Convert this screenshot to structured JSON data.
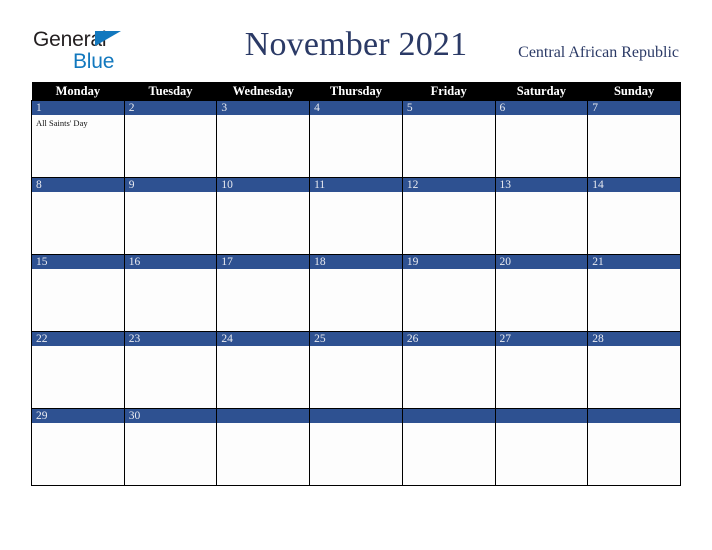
{
  "brand": {
    "name_part1": "General",
    "name_part2": "Blue",
    "triangle_icon": "triangle-icon",
    "color_primary": "#1278be",
    "color_text": "#231f20"
  },
  "header": {
    "title": "November 2021",
    "country": "Central African Republic",
    "title_color": "#2b3a66"
  },
  "calendar": {
    "accent_color": "#2e5191",
    "header_bg": "#000000",
    "weekday_headers": [
      "Monday",
      "Tuesday",
      "Wednesday",
      "Thursday",
      "Friday",
      "Saturday",
      "Sunday"
    ],
    "weeks": [
      [
        {
          "day": "1",
          "events": [
            "All Saints' Day"
          ]
        },
        {
          "day": "2",
          "events": []
        },
        {
          "day": "3",
          "events": []
        },
        {
          "day": "4",
          "events": []
        },
        {
          "day": "5",
          "events": []
        },
        {
          "day": "6",
          "events": []
        },
        {
          "day": "7",
          "events": []
        }
      ],
      [
        {
          "day": "8",
          "events": []
        },
        {
          "day": "9",
          "events": []
        },
        {
          "day": "10",
          "events": []
        },
        {
          "day": "11",
          "events": []
        },
        {
          "day": "12",
          "events": []
        },
        {
          "day": "13",
          "events": []
        },
        {
          "day": "14",
          "events": []
        }
      ],
      [
        {
          "day": "15",
          "events": []
        },
        {
          "day": "16",
          "events": []
        },
        {
          "day": "17",
          "events": []
        },
        {
          "day": "18",
          "events": []
        },
        {
          "day": "19",
          "events": []
        },
        {
          "day": "20",
          "events": []
        },
        {
          "day": "21",
          "events": []
        }
      ],
      [
        {
          "day": "22",
          "events": []
        },
        {
          "day": "23",
          "events": []
        },
        {
          "day": "24",
          "events": []
        },
        {
          "day": "25",
          "events": []
        },
        {
          "day": "26",
          "events": []
        },
        {
          "day": "27",
          "events": []
        },
        {
          "day": "28",
          "events": []
        }
      ],
      [
        {
          "day": "29",
          "events": []
        },
        {
          "day": "30",
          "events": []
        },
        {
          "day": "",
          "events": []
        },
        {
          "day": "",
          "events": []
        },
        {
          "day": "",
          "events": []
        },
        {
          "day": "",
          "events": []
        },
        {
          "day": "",
          "events": []
        }
      ]
    ]
  }
}
